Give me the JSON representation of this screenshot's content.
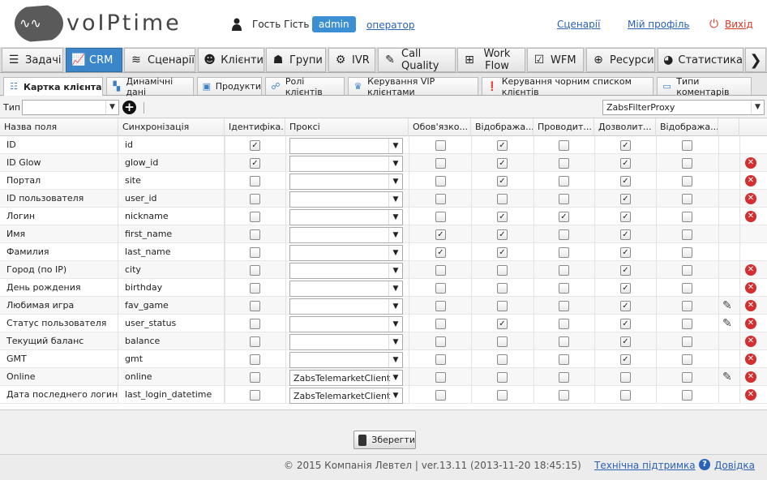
{
  "header": {
    "logo_text": "voIPtime",
    "user_name": "Гость Гість",
    "role": "admin",
    "role_link": "оператор",
    "links": [
      "Сценарії",
      "Мій профіль"
    ],
    "logout": "Вихід"
  },
  "main_tabs": [
    {
      "label": "Задачі",
      "icon": "tasks-icon"
    },
    {
      "label": "CRM",
      "icon": "crm-chart-icon",
      "active": true
    },
    {
      "label": "Сценарії",
      "icon": "scenarios-icon"
    },
    {
      "label": "Клієнти",
      "icon": "clients-icon"
    },
    {
      "label": "Групи",
      "icon": "groups-icon"
    },
    {
      "label": "IVR",
      "icon": "ivr-icon"
    },
    {
      "label": "Call Quality",
      "icon": "call-quality-icon"
    },
    {
      "label": "Work Flow",
      "icon": "workflow-icon"
    },
    {
      "label": "WFM",
      "icon": "wfm-icon"
    },
    {
      "label": "Ресурси",
      "icon": "resources-icon"
    },
    {
      "label": "Статистика",
      "icon": "statistics-icon"
    }
  ],
  "sub_tabs": [
    {
      "label": "Картка клієнта",
      "active": true
    },
    {
      "label": "Динамічні дані"
    },
    {
      "label": "Продукти"
    },
    {
      "label": "Ролі клієнтів"
    },
    {
      "label": "Керування VIP клієнтами"
    },
    {
      "label": "Керування чорним списком клієнтів"
    },
    {
      "label": "Типи коментарів"
    }
  ],
  "filter": {
    "type_label": "Тип",
    "type_value": "",
    "proxy_filter": "ZabsFilterProxy"
  },
  "columns": [
    "Назва поля",
    "Синхронізація",
    "Ідентифіка...",
    "Проксі",
    "Обов'язко...",
    "Відобража...",
    "Проводит...",
    "Дозволит...",
    "Відобража..."
  ],
  "rows": [
    {
      "name": "ID",
      "sync": "id",
      "ident": true,
      "proxy": "",
      "req": false,
      "disp": true,
      "cond": false,
      "allow": true,
      "disp2": false,
      "edit": false,
      "del": false
    },
    {
      "name": "ID Glow",
      "sync": "glow_id",
      "ident": true,
      "proxy": "",
      "req": false,
      "disp": true,
      "cond": false,
      "allow": true,
      "disp2": false,
      "edit": false,
      "del": true
    },
    {
      "name": "Портал",
      "sync": "site",
      "ident": false,
      "proxy": "",
      "req": false,
      "disp": true,
      "cond": false,
      "allow": true,
      "disp2": false,
      "edit": false,
      "del": true
    },
    {
      "name": "ID пользователя",
      "sync": "user_id",
      "ident": false,
      "proxy": "",
      "req": false,
      "disp": false,
      "cond": false,
      "allow": true,
      "disp2": false,
      "edit": false,
      "del": true
    },
    {
      "name": "Логин",
      "sync": "nickname",
      "ident": false,
      "proxy": "",
      "req": false,
      "disp": true,
      "cond": true,
      "allow": true,
      "disp2": false,
      "edit": false,
      "del": true
    },
    {
      "name": "Имя",
      "sync": "first_name",
      "ident": false,
      "proxy": "",
      "req": true,
      "disp": true,
      "cond": false,
      "allow": true,
      "disp2": false,
      "edit": false,
      "del": false
    },
    {
      "name": "Фамилия",
      "sync": "last_name",
      "ident": false,
      "proxy": "",
      "req": true,
      "disp": true,
      "cond": false,
      "allow": true,
      "disp2": false,
      "edit": false,
      "del": false
    },
    {
      "name": "Город (по IP)",
      "sync": "city",
      "ident": false,
      "proxy": "",
      "req": false,
      "disp": false,
      "cond": false,
      "allow": true,
      "disp2": false,
      "edit": false,
      "del": true
    },
    {
      "name": "День рождения",
      "sync": "birthday",
      "ident": false,
      "proxy": "",
      "req": false,
      "disp": false,
      "cond": false,
      "allow": true,
      "disp2": false,
      "edit": false,
      "del": true
    },
    {
      "name": "Любимая игра",
      "sync": "fav_game",
      "ident": false,
      "proxy": "",
      "req": false,
      "disp": false,
      "cond": false,
      "allow": true,
      "disp2": false,
      "edit": true,
      "del": true
    },
    {
      "name": "Статус пользователя",
      "sync": "user_status",
      "ident": false,
      "proxy": "",
      "req": false,
      "disp": true,
      "cond": false,
      "allow": true,
      "disp2": false,
      "edit": true,
      "del": true
    },
    {
      "name": "Текущий баланс",
      "sync": "balance",
      "ident": false,
      "proxy": "",
      "req": false,
      "disp": false,
      "cond": false,
      "allow": true,
      "disp2": false,
      "edit": false,
      "del": true
    },
    {
      "name": "GMT",
      "sync": "gmt",
      "ident": false,
      "proxy": "",
      "req": false,
      "disp": false,
      "cond": false,
      "allow": true,
      "disp2": false,
      "edit": false,
      "del": true
    },
    {
      "name": "Online",
      "sync": "online",
      "ident": false,
      "proxy": "ZabsTelemarketClient",
      "req": false,
      "disp": false,
      "cond": false,
      "allow": false,
      "disp2": false,
      "edit": true,
      "del": true
    },
    {
      "name": "Дата последнего логин...",
      "sync": "last_login_datetime",
      "ident": false,
      "proxy": "ZabsTelemarketClient",
      "req": false,
      "disp": false,
      "cond": false,
      "allow": false,
      "disp2": false,
      "edit": false,
      "del": true
    }
  ],
  "save_label": "Зберегти",
  "footer": {
    "copyright": "© 2015 Компанія Левтел | ver.13.11 (2013-11-20 18:45:15)",
    "support": "Технічна підтримка",
    "help": "Довідка"
  },
  "colors": {
    "accent": "#3a86c8",
    "link": "#2a62b7",
    "danger": "#d32f2f"
  }
}
